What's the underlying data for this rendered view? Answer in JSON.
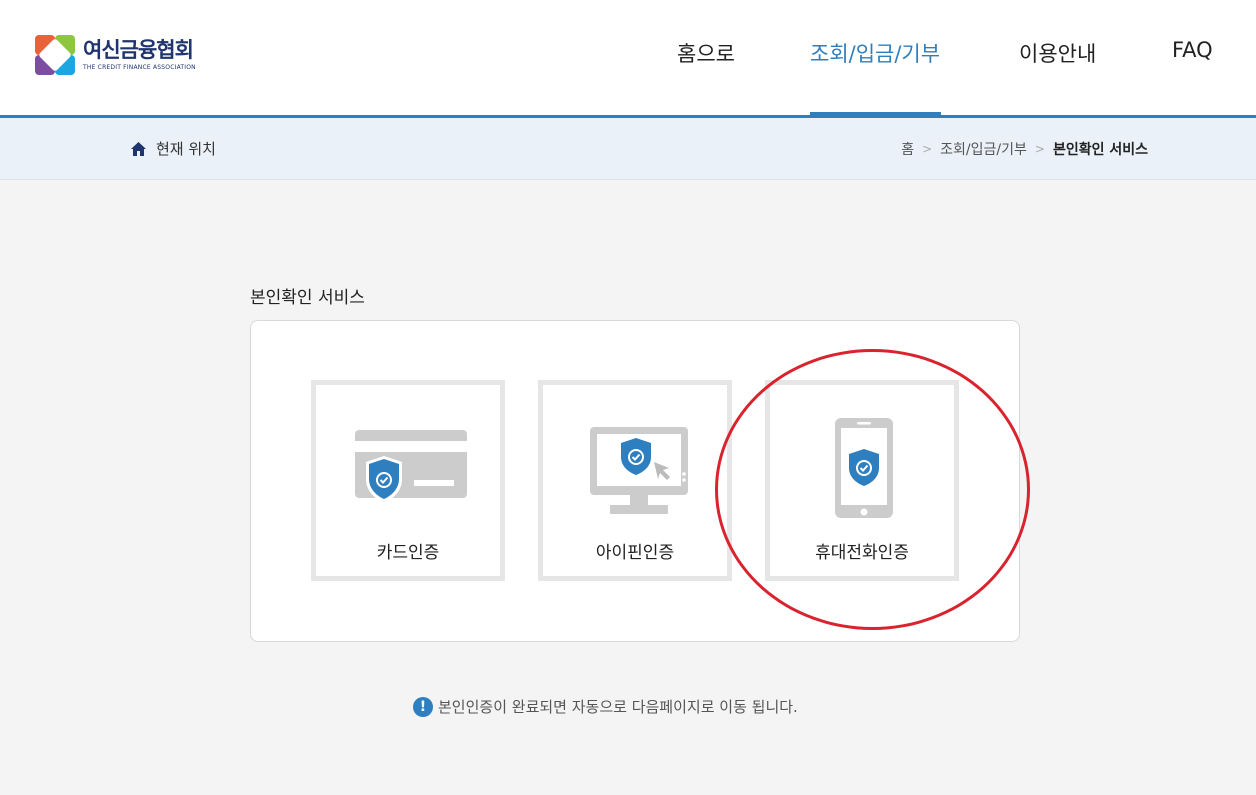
{
  "header": {
    "logo_ko": "여신금융협회",
    "logo_en": "THE CREDIT FINANCE ASSOCIATION",
    "nav": [
      {
        "label": "홈으로"
      },
      {
        "label": "조회/입금/기부",
        "active": true
      },
      {
        "label": "이용안내"
      },
      {
        "label": "FAQ"
      }
    ]
  },
  "breadcrumb": {
    "location_label": "현재 위치",
    "items": [
      "홈",
      "조회/입금/기부",
      "본인확인 서비스"
    ],
    "icon": "home-icon"
  },
  "main": {
    "title": "본인확인 서비스",
    "options": [
      {
        "label": "카드인증",
        "icon": "credit-card-shield-icon"
      },
      {
        "label": "아이핀인증",
        "icon": "monitor-shield-icon"
      },
      {
        "label": "휴대전화인증",
        "icon": "phone-shield-icon",
        "highlighted": true
      }
    ],
    "notice": "본인인증이 완료되면 자동으로 다음페이지로 이동 됩니다."
  },
  "colors": {
    "accent": "#2e7fbf",
    "brand_navy": "#20346e",
    "highlight": "#d9232e"
  }
}
